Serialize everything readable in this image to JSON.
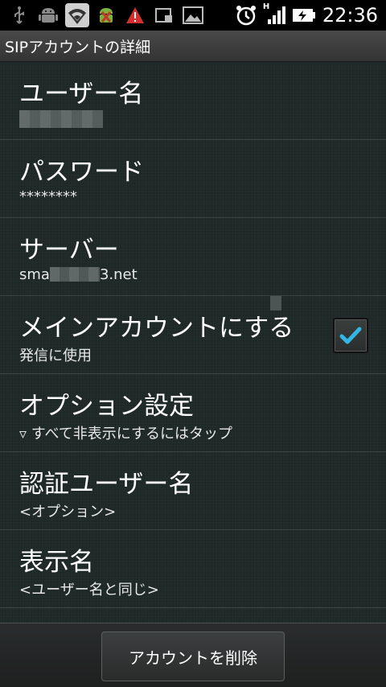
{
  "status_bar": {
    "icons": [
      "usb-icon",
      "android-debug-icon",
      "wifi-icon",
      "android-alert-icon",
      "warning-icon",
      "screenshot-icon",
      "image-icon",
      "alarm-icon",
      "signal-icon",
      "battery-charging-icon"
    ],
    "network_type": "H",
    "time": "22:36"
  },
  "title": "SIPアカウントの詳細",
  "prefs": [
    {
      "title": "ユーザー名",
      "summary": ""
    },
    {
      "title": "パスワード",
      "summary": "********"
    },
    {
      "title": "サーバー",
      "summary_prefix": "sma",
      "summary_suffix": "3.net"
    },
    {
      "title": "メインアカウントにする",
      "summary": "発信に使用",
      "checked": true
    },
    {
      "title": "オプション設定",
      "summary": "▿ すべて非表示にするにはタップ"
    },
    {
      "title": "認証ユーザー名",
      "summary": "<オプション>"
    },
    {
      "title": "表示名",
      "summary": "<ユーザー名と同じ>"
    }
  ],
  "delete_button_label": "アカウントを削除",
  "colors": {
    "background": "#1f2a28",
    "checkmark": "#33b5e5"
  }
}
